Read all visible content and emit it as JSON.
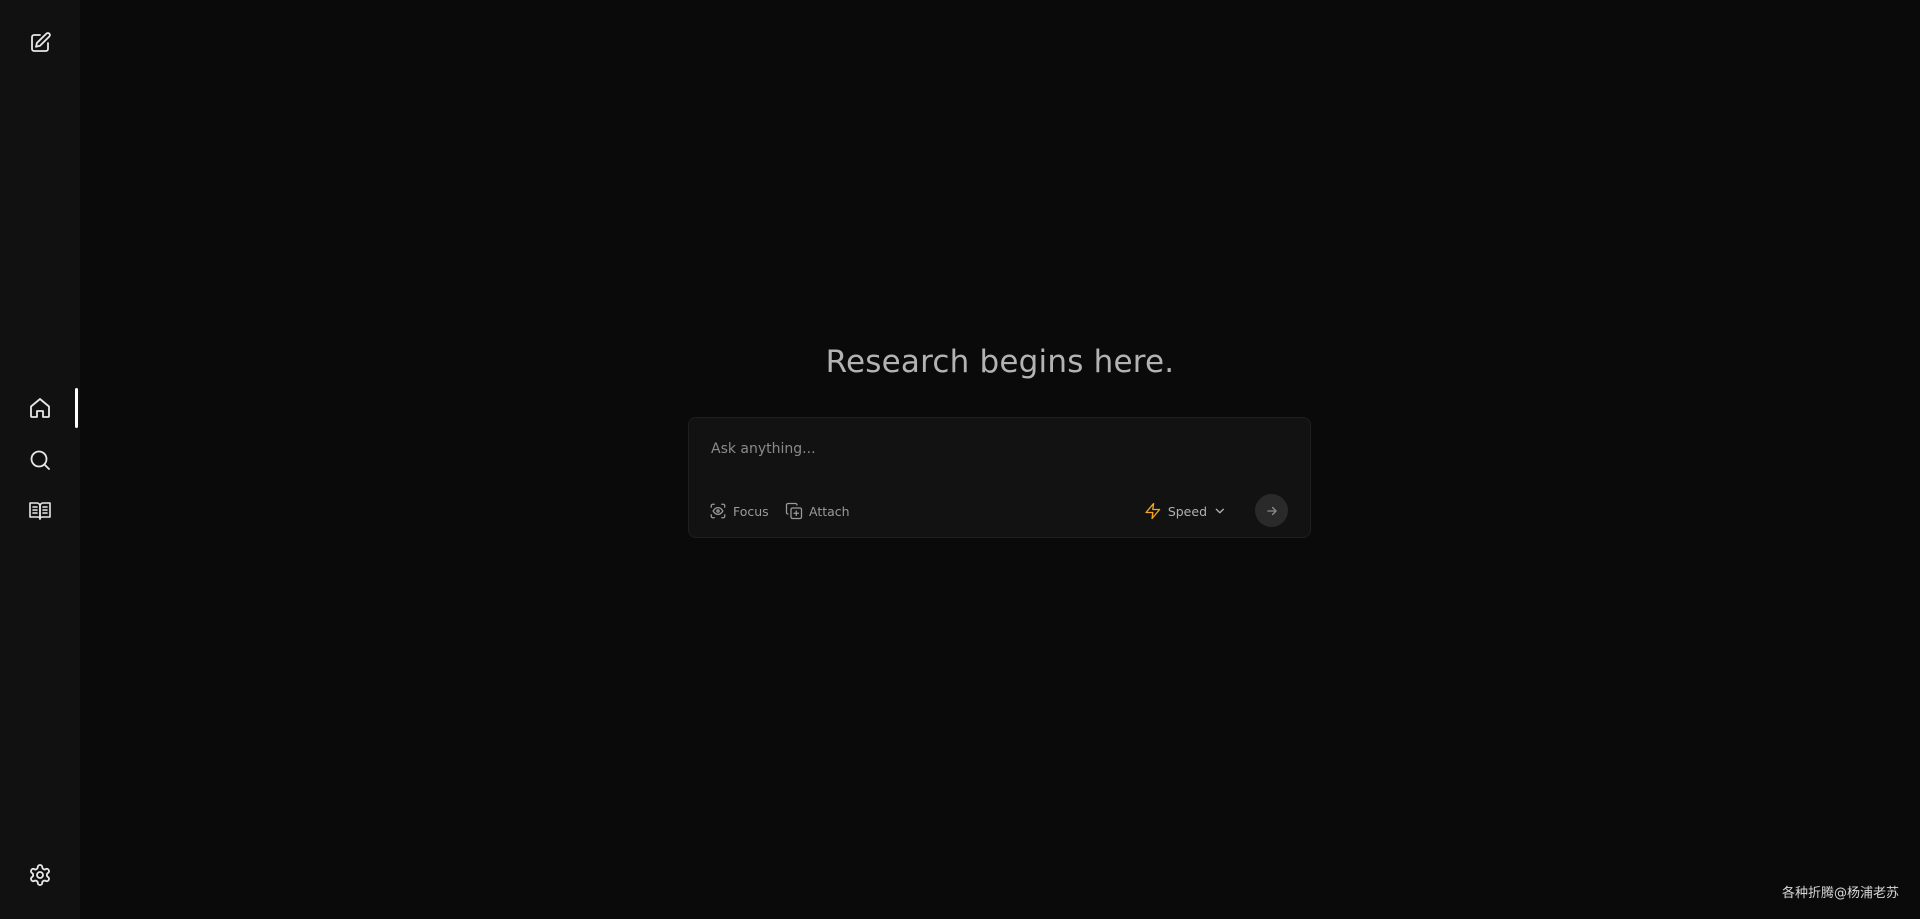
{
  "sidebar": {
    "new_chat_icon": "pencil-square-icon",
    "nav_items": [
      {
        "id": "home",
        "icon": "home-icon",
        "active": true
      },
      {
        "id": "discover",
        "icon": "search-icon",
        "active": false
      },
      {
        "id": "library",
        "icon": "book-open-icon",
        "active": false
      }
    ],
    "settings_icon": "gear-icon"
  },
  "main": {
    "title": "Research begins here.",
    "search": {
      "placeholder": "Ask anything...",
      "value": ""
    },
    "toolbar": {
      "focus_label": "Focus",
      "attach_label": "Attach",
      "speed_label": "Speed",
      "send_icon": "arrow-right-icon"
    }
  },
  "watermark": "各种折腾@杨浦老苏",
  "colors": {
    "background": "#0a0a0a",
    "sidebar": "#111111",
    "accent_speed": "#f5a524",
    "title": "#b3b3b3"
  }
}
